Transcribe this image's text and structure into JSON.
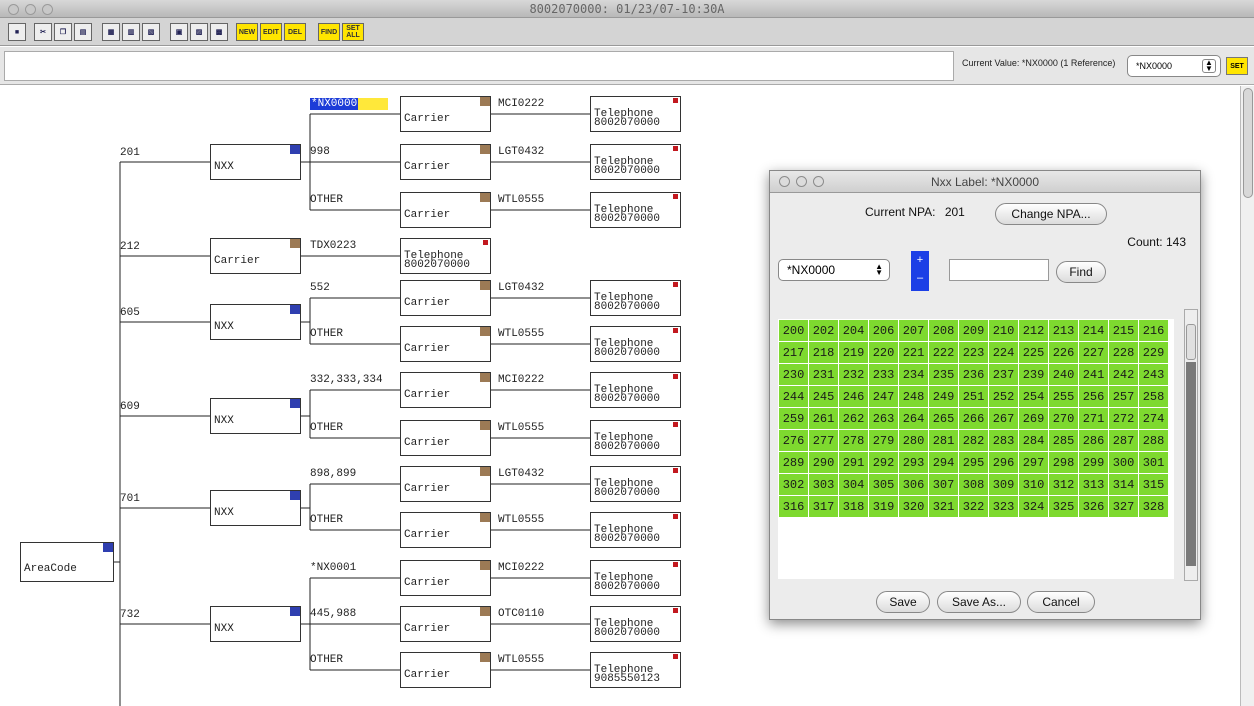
{
  "window": {
    "title": "8002070000: 01/23/07-10:30A"
  },
  "toolbar": {
    "new_label": "NEW",
    "edit_label": "EDIT",
    "del_label": "DEL",
    "find_label": "FIND",
    "setall_label": "SET ALL"
  },
  "valuebar": {
    "current_value": "Current Value: *NX0000 (1 Reference)",
    "selected": "*NX0000",
    "set_label": "SET"
  },
  "tree": {
    "root": "AreaCode",
    "nxx": "NXX",
    "carrier": "Carrier",
    "telephone": "Telephone",
    "edges_l1": [
      "201",
      "212",
      "605",
      "609",
      "701",
      "732"
    ],
    "edges_l2": [
      "*NX0000",
      "998",
      "OTHER",
      "TDX0223",
      "552",
      "OTHER",
      "332,333,334",
      "OTHER",
      "898,899",
      "OTHER",
      "*NX0001",
      "445,988",
      "OTHER"
    ],
    "carrier_codes": [
      "MCI0222",
      "LGT0432",
      "WTL0555",
      "LGT0432",
      "WTL0555",
      "MCI0222",
      "WTL0555",
      "LGT0432",
      "WTL0555",
      "MCI0222",
      "OTC0110",
      "WTL0555"
    ],
    "phones": [
      "8002070000",
      "8002070000",
      "8002070000",
      "8002070000",
      "8002070000",
      "8002070000",
      "8002070000",
      "8002070000",
      "8002070000",
      "8002070000",
      "8002070000",
      "9085550123",
      "8002070000"
    ]
  },
  "dialog": {
    "title": "Nxx Label: *NX0000",
    "current_npa_label": "Current NPA:",
    "current_npa": "201",
    "change_npa_label": "Change NPA...",
    "count": "Count: 143",
    "selected_label": "*NX0000",
    "plus": "+",
    "minus": "–",
    "find_label": "Find",
    "find_value": "",
    "codes": [
      [
        "200",
        "202",
        "204",
        "206",
        "207",
        "208",
        "209",
        "210",
        "212",
        "213",
        "214",
        "215",
        "216"
      ],
      [
        "217",
        "218",
        "219",
        "220",
        "221",
        "222",
        "223",
        "224",
        "225",
        "226",
        "227",
        "228",
        "229"
      ],
      [
        "230",
        "231",
        "232",
        "233",
        "234",
        "235",
        "236",
        "237",
        "239",
        "240",
        "241",
        "242",
        "243"
      ],
      [
        "244",
        "245",
        "246",
        "247",
        "248",
        "249",
        "251",
        "252",
        "254",
        "255",
        "256",
        "257",
        "258"
      ],
      [
        "259",
        "261",
        "262",
        "263",
        "264",
        "265",
        "266",
        "267",
        "269",
        "270",
        "271",
        "272",
        "274"
      ],
      [
        "276",
        "277",
        "278",
        "279",
        "280",
        "281",
        "282",
        "283",
        "284",
        "285",
        "286",
        "287",
        "288"
      ],
      [
        "289",
        "290",
        "291",
        "292",
        "293",
        "294",
        "295",
        "296",
        "297",
        "298",
        "299",
        "300",
        "301"
      ],
      [
        "302",
        "303",
        "304",
        "305",
        "306",
        "307",
        "308",
        "309",
        "310",
        "312",
        "313",
        "314",
        "315"
      ],
      [
        "316",
        "317",
        "318",
        "319",
        "320",
        "321",
        "322",
        "323",
        "324",
        "325",
        "326",
        "327",
        "328"
      ]
    ],
    "save_label": "Save",
    "save_as_label": "Save As...",
    "cancel_label": "Cancel"
  },
  "colors": {
    "code_cell": "#7ed92f",
    "highlight": "#ffe83a",
    "selection_blue": "#1c3cd8",
    "toolbar_yellow": "#ffe500"
  }
}
